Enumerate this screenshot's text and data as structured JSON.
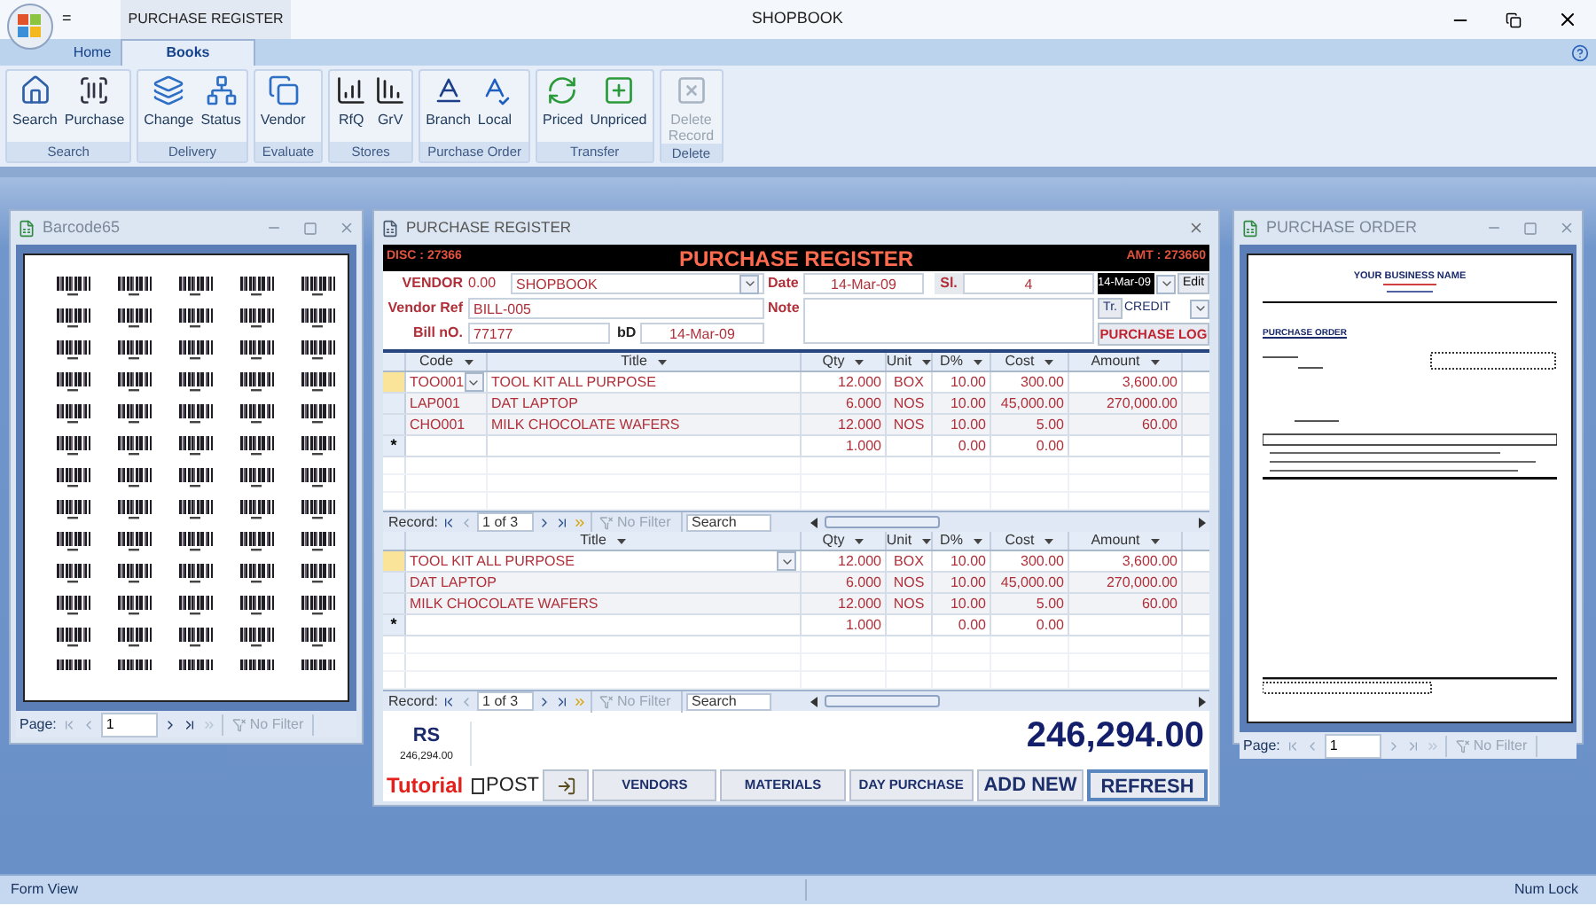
{
  "app": {
    "title": "SHOPBOOK",
    "quick_access": "=",
    "context_tab": "PURCHASE REGISTER"
  },
  "tabs": [
    {
      "label": "Home",
      "selected": false
    },
    {
      "label": "Books",
      "selected": true
    }
  ],
  "ribbon": [
    {
      "label": "Search",
      "buttons": [
        {
          "label": "Search",
          "disabled": false
        },
        {
          "label": "Purchase",
          "disabled": false
        }
      ]
    },
    {
      "label": "Delivery",
      "buttons": [
        {
          "label": "Change",
          "disabled": false
        },
        {
          "label": "Status",
          "disabled": false
        }
      ]
    },
    {
      "label": "Evaluate",
      "buttons": [
        {
          "label": "Vendor",
          "disabled": false
        }
      ]
    },
    {
      "label": "Stores",
      "buttons": [
        {
          "label": "RfQ",
          "disabled": false
        },
        {
          "label": "GrV",
          "disabled": false
        }
      ]
    },
    {
      "label": "Purchase Order",
      "buttons": [
        {
          "label": "Branch",
          "disabled": false
        },
        {
          "label": "Local",
          "disabled": false
        }
      ]
    },
    {
      "label": "Transfer",
      "buttons": [
        {
          "label": "Priced",
          "disabled": false
        },
        {
          "label": "Unpriced",
          "disabled": false
        }
      ]
    },
    {
      "label": "Delete",
      "buttons": [
        {
          "label": "Delete Record",
          "disabled": true
        }
      ]
    }
  ],
  "barcode_window": {
    "title": "Barcode65",
    "page_label": "Page:",
    "page": "1",
    "filter": "No Filter"
  },
  "register": {
    "title": "PURCHASE REGISTER",
    "disc": "DISC : 27366",
    "heading": "PURCHASE REGISTER",
    "amt": "AMT : 273660",
    "vendor_label": "VENDOR",
    "vendor_balance": "0.00",
    "vendor": "SHOPBOOK",
    "date_label": "Date",
    "date": "14-Mar-09",
    "sl_label": "Sl.",
    "sl": "4",
    "date_picker": "14-Mar-09",
    "edit_button": "Edit",
    "vendor_ref_label": "Vendor Ref",
    "vendor_ref": "BILL-005",
    "note_label": "Note",
    "tr_button": "Tr.",
    "tr": "CREDIT",
    "bill_no_label": "Bill nO.",
    "bill_no": "77177",
    "bd_label": "bD",
    "bd": "14-Mar-09",
    "log_button": "PURCHASE LOG",
    "items_grid": {
      "columns": [
        "Code",
        "Title",
        "Qty",
        "Unit",
        "D%",
        "Cost",
        "Amount"
      ],
      "rows": [
        {
          "selected": true,
          "cells": [
            "TOO001",
            "TOOL KIT ALL PURPOSE",
            "12.000",
            "BOX",
            "10.00",
            "300.00",
            "3,600.00"
          ]
        },
        {
          "selected": false,
          "cells": [
            "LAP001",
            "DAT LAPTOP",
            "6.000",
            "NOS",
            "10.00",
            "45,000.00",
            "270,000.00"
          ]
        },
        {
          "selected": false,
          "cells": [
            "CHO001",
            "MILK CHOCOLATE WAFERS",
            "12.000",
            "NOS",
            "10.00",
            "5.00",
            "60.00"
          ]
        }
      ],
      "new_row": {
        "marker": "*",
        "cells": [
          null,
          null,
          "1.000",
          null,
          "0.00",
          "0.00",
          null
        ]
      }
    },
    "items_nav": {
      "label": "Record:",
      "position": "1 of 3",
      "filter": "No Filter",
      "search_placeholder": "Search"
    },
    "titles_grid": {
      "columns": [
        "Title",
        "Qty",
        "Unit",
        "D%",
        "Cost",
        "Amount"
      ],
      "rows": [
        {
          "selected": true,
          "cells": [
            "TOOL KIT ALL PURPOSE",
            "12.000",
            "BOX",
            "10.00",
            "300.00",
            "3,600.00"
          ]
        },
        {
          "selected": false,
          "cells": [
            "DAT LAPTOP",
            "6.000",
            "NOS",
            "10.00",
            "45,000.00",
            "270,000.00"
          ]
        },
        {
          "selected": false,
          "cells": [
            "MILK CHOCOLATE WAFERS",
            "12.000",
            "NOS",
            "10.00",
            "5.00",
            "60.00"
          ]
        }
      ],
      "new_row": {
        "marker": "*",
        "cells": [
          null,
          "1.000",
          null,
          "0.00",
          "0.00",
          null
        ]
      }
    },
    "titles_nav": {
      "label": "Record:",
      "position": "1 of 3",
      "filter": "No Filter",
      "search_placeholder": "Search"
    },
    "currency": "RS",
    "total_small": "246,294.00",
    "total": "246,294.00",
    "buttons": [
      {
        "kind": "tutorial",
        "label": "Tutorial"
      },
      {
        "kind": "checkbox",
        "label": "POST",
        "checked": false
      },
      {
        "kind": "exit"
      },
      {
        "kind": "small",
        "label": "VENDORS"
      },
      {
        "kind": "small",
        "label": "MATERIALS"
      },
      {
        "kind": "small",
        "label": "DAY PURCHASE"
      },
      {
        "kind": "large",
        "label": "ADD NEW"
      },
      {
        "kind": "focused",
        "label": "REFRESH"
      }
    ]
  },
  "order_window": {
    "title": "PURCHASE ORDER",
    "business_name": "YOUR BUSINESS NAME",
    "doc_title": "PURCHASE ORDER",
    "page_label": "Page:",
    "page": "1",
    "filter": "No Filter"
  },
  "status_bar": {
    "left": "Form View",
    "right": "Num Lock"
  }
}
